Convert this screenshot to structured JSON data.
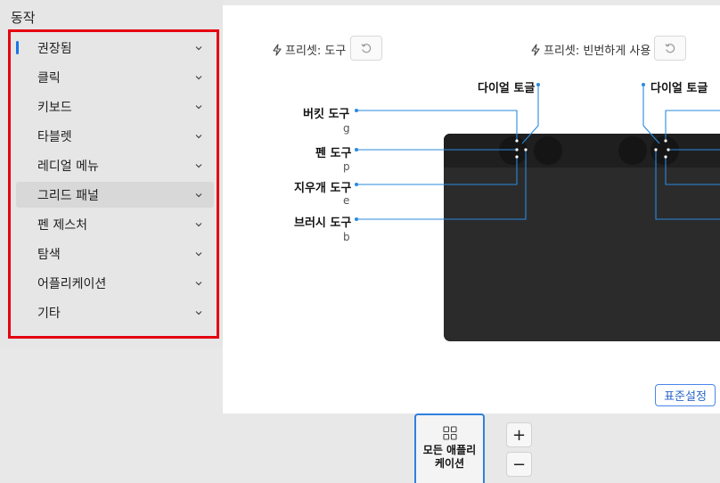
{
  "sidebar": {
    "title": "동작",
    "items": [
      {
        "label": "권장됨",
        "active": true
      },
      {
        "label": "클릭"
      },
      {
        "label": "키보드"
      },
      {
        "label": "타블렛"
      },
      {
        "label": "레디얼 메뉴"
      },
      {
        "label": "그리드 패널",
        "hovered": true
      },
      {
        "label": "펜 제스처"
      },
      {
        "label": "탐색"
      },
      {
        "label": "어플리케이션"
      },
      {
        "label": "기타"
      }
    ],
    "chevron_icon": "chevron-down-icon"
  },
  "panel": {
    "preset_left": "프리셋: 도구",
    "preset_right": "프리셋: 빈번하게 사용",
    "preset_icon": "lightning-icon",
    "reset_icon": "rotate-ccw-icon",
    "dial_toggle_left": "다이얼 토글",
    "dial_toggle_right": "다이얼 토글",
    "tools": [
      {
        "label": "버킷 도구",
        "key": "g"
      },
      {
        "label": "펜 도구",
        "key": "p"
      },
      {
        "label": "지우개 도구",
        "key": "e"
      },
      {
        "label": "브러시 도구",
        "key": "b"
      }
    ],
    "default_button": "표준설정"
  },
  "bottom": {
    "all_apps_line1": "모든 애플리",
    "all_apps_line2": "케이션",
    "zoom_in": "+",
    "zoom_out": "−"
  },
  "colors": {
    "accent": "#1a73e8",
    "highlight_border": "#e4000f",
    "leader_line": "#2a8ae0"
  }
}
